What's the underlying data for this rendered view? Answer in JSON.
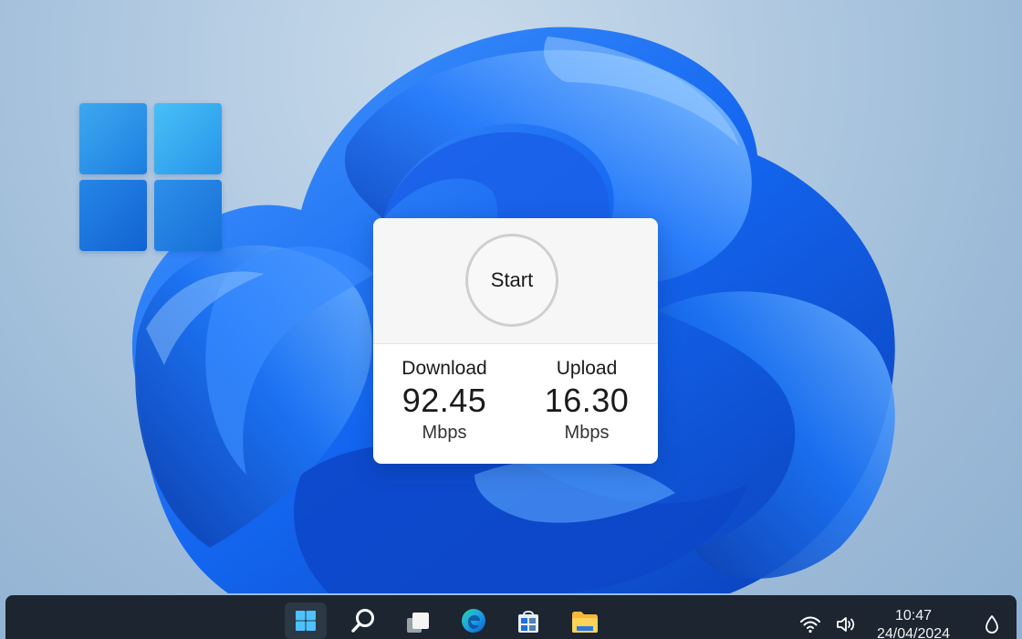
{
  "speed_test": {
    "start_label": "Start",
    "download": {
      "label": "Download",
      "value": "92.45",
      "unit": "Mbps"
    },
    "upload": {
      "label": "Upload",
      "value": "16.30",
      "unit": "Mbps"
    }
  },
  "taskbar": {
    "apps": [
      {
        "icon": "windows-start-icon"
      },
      {
        "icon": "search-icon"
      },
      {
        "icon": "task-view-icon"
      },
      {
        "icon": "edge-browser-icon"
      },
      {
        "icon": "store-icon"
      },
      {
        "icon": "file-explorer-icon"
      }
    ],
    "tray": {
      "icons": [
        "wifi-icon",
        "volume-icon",
        "notification-icon"
      ],
      "time": "10:47",
      "date": "24/04/2024"
    }
  },
  "colors": {
    "accent": "#1a6fe0",
    "taskbar": "#1c2530",
    "card": "#ffffff"
  }
}
